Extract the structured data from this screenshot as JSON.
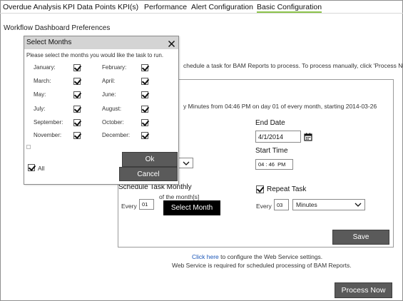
{
  "tabs": [
    {
      "label": "Overdue Analysis",
      "active": false
    },
    {
      "label": "KPI Data Points",
      "active": false
    },
    {
      "label": "KPI(s)",
      "active": false
    },
    {
      "label": "Performance",
      "active": false
    },
    {
      "label": "Alert Configuration",
      "active": false
    },
    {
      "label": "Basic Configuration",
      "active": true
    }
  ],
  "page": {
    "section_title": "Workflow Dashboard Preferences",
    "intro_text_partial": "chedule a task for BAM Reports to process. To process manually, click 'Process Now'.",
    "schedule_summary_partial": "y Minutes from 04:46 PM on day 01 of every month, starting 2014-03-26"
  },
  "form": {
    "end_date_label": "End Date",
    "end_date_value": "4/1/2014",
    "start_time_label": "Start Time",
    "start_time_value": "04 : 46  PM",
    "schedule_monthly_label": "Schedule Task Monthly",
    "every_label": "Every",
    "day_value": "01",
    "of_month_label": "of the month[s]",
    "select_month_button": "Select Month",
    "repeat_task_label": "Repeat Task",
    "repeat_task_checked": true,
    "repeat_every_label": "Every",
    "repeat_every_value": "03",
    "repeat_unit_value": "Minutes",
    "save_button": "Save"
  },
  "footer": {
    "link_text": "Click here",
    "link_suffix": " to configure the Web Service settings.",
    "note": "Web Service is required for scheduled processing of BAM Reports.",
    "process_now_button": "Process Now"
  },
  "dialog": {
    "title": "Select Months",
    "instruction": "Please select the months you would like the task to run.",
    "months": [
      {
        "label": "January:",
        "checked": true
      },
      {
        "label": "February:",
        "checked": true
      },
      {
        "label": "March:",
        "checked": true
      },
      {
        "label": "April:",
        "checked": true
      },
      {
        "label": "May:",
        "checked": true
      },
      {
        "label": "June:",
        "checked": true
      },
      {
        "label": "July:",
        "checked": true
      },
      {
        "label": "August:",
        "checked": true
      },
      {
        "label": "September:",
        "checked": true
      },
      {
        "label": "October:",
        "checked": true
      },
      {
        "label": "November:",
        "checked": true
      },
      {
        "label": "December:",
        "checked": true
      }
    ],
    "all_label": "All",
    "all_checked": true,
    "ok_button": "Ok",
    "cancel_button": "Cancel"
  },
  "colors": {
    "active_tab_underline": "#8bc34a",
    "dialog_header": "#d4d4d4",
    "dark_button": "#5a5a5a",
    "link": "#1a56b8"
  },
  "icons": [
    "calendar-icon",
    "close-icon",
    "chevron-down-icon"
  ]
}
